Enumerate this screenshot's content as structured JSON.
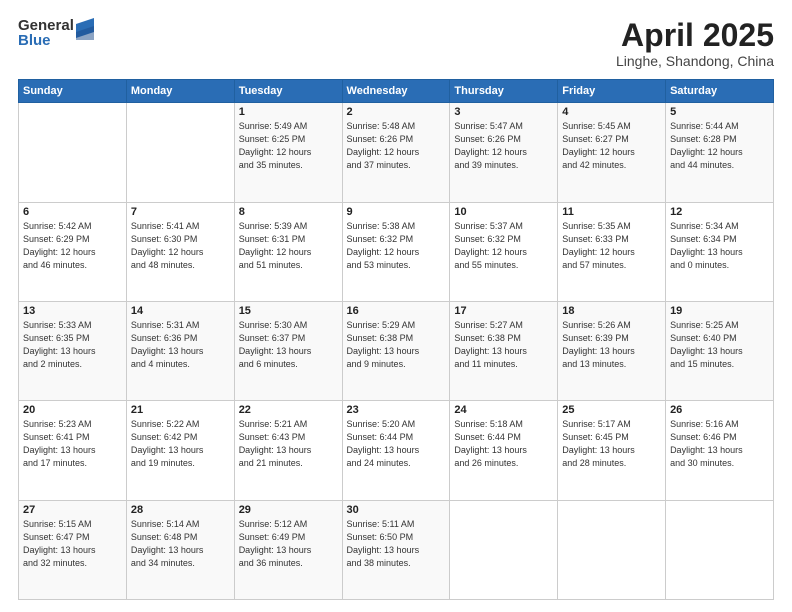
{
  "logo": {
    "general": "General",
    "blue": "Blue"
  },
  "title": "April 2025",
  "subtitle": "Linghe, Shandong, China",
  "headers": [
    "Sunday",
    "Monday",
    "Tuesday",
    "Wednesday",
    "Thursday",
    "Friday",
    "Saturday"
  ],
  "weeks": [
    [
      {
        "day": "",
        "info": ""
      },
      {
        "day": "",
        "info": ""
      },
      {
        "day": "1",
        "info": "Sunrise: 5:49 AM\nSunset: 6:25 PM\nDaylight: 12 hours\nand 35 minutes."
      },
      {
        "day": "2",
        "info": "Sunrise: 5:48 AM\nSunset: 6:26 PM\nDaylight: 12 hours\nand 37 minutes."
      },
      {
        "day": "3",
        "info": "Sunrise: 5:47 AM\nSunset: 6:26 PM\nDaylight: 12 hours\nand 39 minutes."
      },
      {
        "day": "4",
        "info": "Sunrise: 5:45 AM\nSunset: 6:27 PM\nDaylight: 12 hours\nand 42 minutes."
      },
      {
        "day": "5",
        "info": "Sunrise: 5:44 AM\nSunset: 6:28 PM\nDaylight: 12 hours\nand 44 minutes."
      }
    ],
    [
      {
        "day": "6",
        "info": "Sunrise: 5:42 AM\nSunset: 6:29 PM\nDaylight: 12 hours\nand 46 minutes."
      },
      {
        "day": "7",
        "info": "Sunrise: 5:41 AM\nSunset: 6:30 PM\nDaylight: 12 hours\nand 48 minutes."
      },
      {
        "day": "8",
        "info": "Sunrise: 5:39 AM\nSunset: 6:31 PM\nDaylight: 12 hours\nand 51 minutes."
      },
      {
        "day": "9",
        "info": "Sunrise: 5:38 AM\nSunset: 6:32 PM\nDaylight: 12 hours\nand 53 minutes."
      },
      {
        "day": "10",
        "info": "Sunrise: 5:37 AM\nSunset: 6:32 PM\nDaylight: 12 hours\nand 55 minutes."
      },
      {
        "day": "11",
        "info": "Sunrise: 5:35 AM\nSunset: 6:33 PM\nDaylight: 12 hours\nand 57 minutes."
      },
      {
        "day": "12",
        "info": "Sunrise: 5:34 AM\nSunset: 6:34 PM\nDaylight: 13 hours\nand 0 minutes."
      }
    ],
    [
      {
        "day": "13",
        "info": "Sunrise: 5:33 AM\nSunset: 6:35 PM\nDaylight: 13 hours\nand 2 minutes."
      },
      {
        "day": "14",
        "info": "Sunrise: 5:31 AM\nSunset: 6:36 PM\nDaylight: 13 hours\nand 4 minutes."
      },
      {
        "day": "15",
        "info": "Sunrise: 5:30 AM\nSunset: 6:37 PM\nDaylight: 13 hours\nand 6 minutes."
      },
      {
        "day": "16",
        "info": "Sunrise: 5:29 AM\nSunset: 6:38 PM\nDaylight: 13 hours\nand 9 minutes."
      },
      {
        "day": "17",
        "info": "Sunrise: 5:27 AM\nSunset: 6:38 PM\nDaylight: 13 hours\nand 11 minutes."
      },
      {
        "day": "18",
        "info": "Sunrise: 5:26 AM\nSunset: 6:39 PM\nDaylight: 13 hours\nand 13 minutes."
      },
      {
        "day": "19",
        "info": "Sunrise: 5:25 AM\nSunset: 6:40 PM\nDaylight: 13 hours\nand 15 minutes."
      }
    ],
    [
      {
        "day": "20",
        "info": "Sunrise: 5:23 AM\nSunset: 6:41 PM\nDaylight: 13 hours\nand 17 minutes."
      },
      {
        "day": "21",
        "info": "Sunrise: 5:22 AM\nSunset: 6:42 PM\nDaylight: 13 hours\nand 19 minutes."
      },
      {
        "day": "22",
        "info": "Sunrise: 5:21 AM\nSunset: 6:43 PM\nDaylight: 13 hours\nand 21 minutes."
      },
      {
        "day": "23",
        "info": "Sunrise: 5:20 AM\nSunset: 6:44 PM\nDaylight: 13 hours\nand 24 minutes."
      },
      {
        "day": "24",
        "info": "Sunrise: 5:18 AM\nSunset: 6:44 PM\nDaylight: 13 hours\nand 26 minutes."
      },
      {
        "day": "25",
        "info": "Sunrise: 5:17 AM\nSunset: 6:45 PM\nDaylight: 13 hours\nand 28 minutes."
      },
      {
        "day": "26",
        "info": "Sunrise: 5:16 AM\nSunset: 6:46 PM\nDaylight: 13 hours\nand 30 minutes."
      }
    ],
    [
      {
        "day": "27",
        "info": "Sunrise: 5:15 AM\nSunset: 6:47 PM\nDaylight: 13 hours\nand 32 minutes."
      },
      {
        "day": "28",
        "info": "Sunrise: 5:14 AM\nSunset: 6:48 PM\nDaylight: 13 hours\nand 34 minutes."
      },
      {
        "day": "29",
        "info": "Sunrise: 5:12 AM\nSunset: 6:49 PM\nDaylight: 13 hours\nand 36 minutes."
      },
      {
        "day": "30",
        "info": "Sunrise: 5:11 AM\nSunset: 6:50 PM\nDaylight: 13 hours\nand 38 minutes."
      },
      {
        "day": "",
        "info": ""
      },
      {
        "day": "",
        "info": ""
      },
      {
        "day": "",
        "info": ""
      }
    ]
  ]
}
